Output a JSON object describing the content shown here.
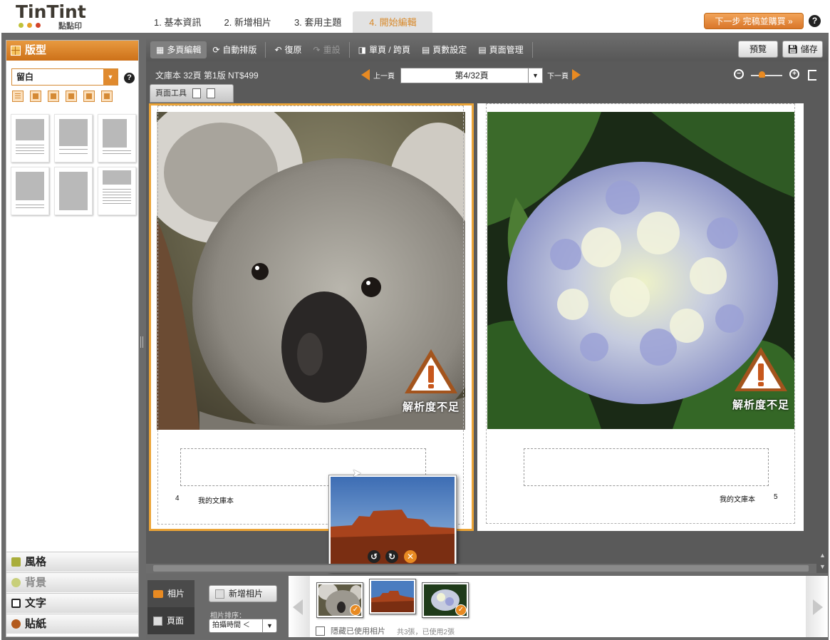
{
  "header": {
    "logo": {
      "word": "TinTint",
      "sub": "點點印"
    },
    "steps": [
      "1. 基本資訊",
      "2. 新增相片",
      "3. 套用主題",
      "4. 開始編輯"
    ],
    "active_step": 3,
    "next_button": "下一步 完稿並購買 »",
    "help": "?"
  },
  "left_panel": {
    "title": "版型",
    "layout_select": "留白",
    "help": "?",
    "categories": [
      "風格",
      "背景",
      "文字",
      "貼紙"
    ]
  },
  "toolbar": {
    "multi_edit": "多頁編輯",
    "auto_layout": "自動排版",
    "undo": "復原",
    "redo": "重設",
    "single_spread": "單頁 / 跨頁",
    "page_settings": "頁數設定",
    "page_manage": "頁面管理",
    "preview": "預覽",
    "save": "儲存"
  },
  "nav": {
    "book_info": "文庫本 32頁 第1版 NT$499",
    "prev": "上一頁",
    "current_page": "第4/32頁",
    "next": "下一頁",
    "page_tools": "頁面工具"
  },
  "pages": {
    "left": {
      "page_number": "4",
      "footer_title": "我的文庫本",
      "warning": "解析度不足"
    },
    "right": {
      "page_number": "5",
      "footer_title": "我的文庫本",
      "warning": "解析度不足"
    }
  },
  "bottom": {
    "tab_photos": "相片",
    "tab_pages": "頁面",
    "add_photo": "新增相片",
    "sort_label": "相片排序：",
    "sort_value": "拍攝時間 ＜",
    "hide_used": "隱藏已使用相片",
    "count": "共3張，已使用2張"
  },
  "colors": {
    "accent": "#e88a22",
    "frame": "#6b6b6b",
    "selected_page_border": "#eba437"
  }
}
